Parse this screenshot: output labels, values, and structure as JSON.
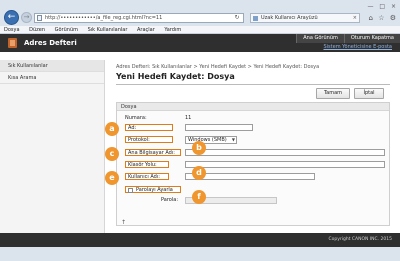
{
  "browser": {
    "address_url": "http://••••••••••••/a_file_reg.cgi.html?nc=11",
    "tab_title": "Uzak Kullanıcı Arayüzü",
    "menu": [
      "Dosya",
      "Düzen",
      "Görünüm",
      "Sık Kullanılanlar",
      "Araçlar",
      "Yardım"
    ]
  },
  "header": {
    "app_title": "Adres Defteri",
    "top_buttons": [
      "Ana Görünüm",
      "Oturum Kapatma"
    ],
    "system_link": "Sistem Yöneticisine E-posta"
  },
  "sidebar": {
    "items": [
      {
        "label": "Sık Kullanılanlar"
      },
      {
        "label": "Kısa Arama"
      }
    ]
  },
  "main": {
    "breadcrumb": "Adres Defteri: Sık Kullanılanlar > Yeni Hedefi Kaydet > Yeni Hedefi Kaydet: Dosya",
    "title": "Yeni Hedefi Kaydet: Dosya",
    "ok_label": "Tamam",
    "cancel_label": "İptal",
    "panel_title": "Dosya",
    "number_label": "Numara:",
    "number_value": "11",
    "name_label": "Ad:",
    "protocol_label": "Protokol:",
    "protocol_value": "Windows (SMB)",
    "host_label": "Ana Bilgisayar Adı:",
    "folder_label": "Klasör Yolu:",
    "user_label": "Kullanıcı Adı:",
    "password_check_label": "Parolayı Ayarla",
    "password_label": "Parola:",
    "scroll_hint": "↑",
    "badges": [
      "a",
      "b",
      "c",
      "d",
      "e",
      "f"
    ],
    "badge_color": "#f0962e"
  },
  "footer": {
    "copyright": "Copyright CANON INC. 2015"
  }
}
